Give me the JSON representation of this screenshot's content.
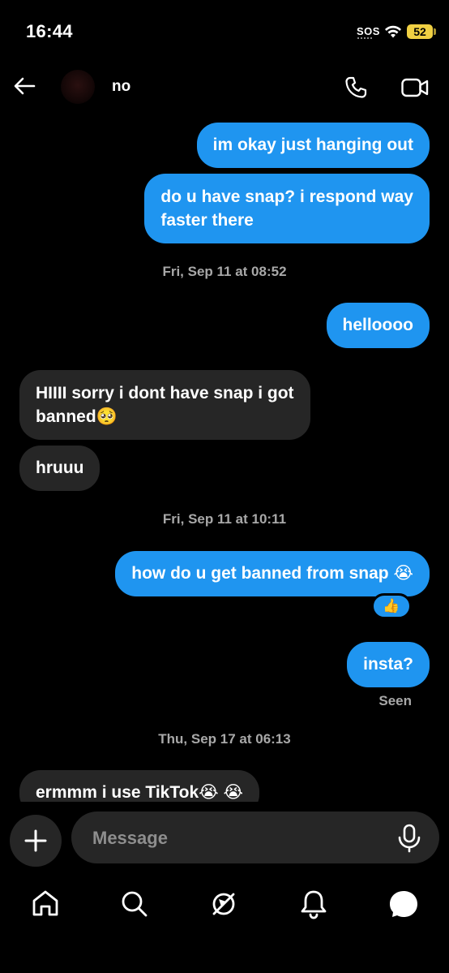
{
  "status_bar": {
    "time": "16:44",
    "sos": "SOS",
    "battery": "52"
  },
  "header": {
    "contact_name": "no"
  },
  "messages": [
    {
      "direction": "sent",
      "text": "im okay just hanging out"
    },
    {
      "direction": "sent",
      "line1": "do u have snap? i respond way",
      "line2": "faster there"
    },
    {
      "direction": "timestamp",
      "text": "Fri, Sep 11 at 08:52"
    },
    {
      "direction": "sent",
      "text": "helloooo"
    },
    {
      "direction": "received",
      "line1": "HIIII sorry i dont have snap i got",
      "line2": "banned",
      "emoji": "🥺"
    },
    {
      "direction": "received",
      "text": "hruuu"
    },
    {
      "direction": "timestamp",
      "text": "Fri, Sep 11 at 10:11"
    },
    {
      "direction": "sent",
      "text": "how do u get banned from snap",
      "emoji": "😭",
      "reaction": "👍"
    },
    {
      "direction": "sent",
      "text": "insta?"
    },
    {
      "direction": "status",
      "text": "Seen"
    },
    {
      "direction": "timestamp",
      "text": "Thu, Sep 17 at 06:13"
    },
    {
      "direction": "received",
      "text": "ermmm i use TikTok",
      "emoji": "😭 😭"
    }
  ],
  "composer": {
    "placeholder": "Message"
  },
  "nav": {
    "items": [
      {
        "icon": "home-icon"
      },
      {
        "icon": "search-icon"
      },
      {
        "icon": "explore-icon"
      },
      {
        "icon": "notifications-icon"
      },
      {
        "icon": "messages-icon"
      }
    ]
  }
}
